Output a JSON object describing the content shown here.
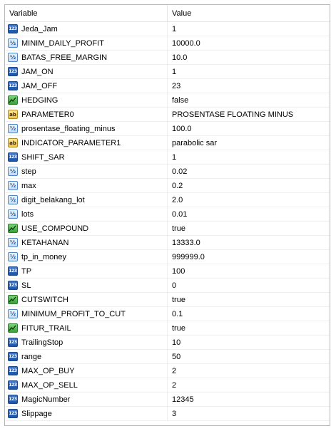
{
  "header": {
    "variable_label": "Variable",
    "value_label": "Value"
  },
  "rows": [
    {
      "type": "int",
      "icon": "integer-icon",
      "name": "Jeda_Jam",
      "value": "1"
    },
    {
      "type": "dbl",
      "icon": "double-icon",
      "name": "MINIM_DAILY_PROFIT",
      "value": "10000.0"
    },
    {
      "type": "dbl",
      "icon": "double-icon",
      "name": "BATAS_FREE_MARGIN",
      "value": "10.0"
    },
    {
      "type": "int",
      "icon": "integer-icon",
      "name": "JAM_ON",
      "value": "1"
    },
    {
      "type": "int",
      "icon": "integer-icon",
      "name": "JAM_OFF",
      "value": "23"
    },
    {
      "type": "bool",
      "icon": "boolean-icon",
      "name": "HEDGING",
      "value": "false"
    },
    {
      "type": "str",
      "icon": "string-icon",
      "name": "PARAMETER0",
      "value": "PROSENTASE FLOATING MINUS"
    },
    {
      "type": "dbl",
      "icon": "double-icon",
      "name": "prosentase_floating_minus",
      "value": "100.0"
    },
    {
      "type": "str",
      "icon": "string-icon",
      "name": "INDICATOR_PARAMETER1",
      "value": "parabolic sar"
    },
    {
      "type": "int",
      "icon": "integer-icon",
      "name": "SHIFT_SAR",
      "value": "1"
    },
    {
      "type": "dbl",
      "icon": "double-icon",
      "name": "step",
      "value": "0.02"
    },
    {
      "type": "dbl",
      "icon": "double-icon",
      "name": "max",
      "value": "0.2"
    },
    {
      "type": "dbl",
      "icon": "double-icon",
      "name": "digit_belakang_lot",
      "value": "2.0"
    },
    {
      "type": "dbl",
      "icon": "double-icon",
      "name": "lots",
      "value": "0.01"
    },
    {
      "type": "bool",
      "icon": "boolean-icon",
      "name": "USE_COMPOUND",
      "value": "true"
    },
    {
      "type": "dbl",
      "icon": "double-icon",
      "name": "KETAHANAN",
      "value": "13333.0"
    },
    {
      "type": "dbl",
      "icon": "double-icon",
      "name": "tp_in_money",
      "value": "999999.0"
    },
    {
      "type": "int",
      "icon": "integer-icon",
      "name": "TP",
      "value": "100"
    },
    {
      "type": "int",
      "icon": "integer-icon",
      "name": "SL",
      "value": "0"
    },
    {
      "type": "bool",
      "icon": "boolean-icon",
      "name": "CUTSWITCH",
      "value": "true"
    },
    {
      "type": "dbl",
      "icon": "double-icon",
      "name": "MINIMUM_PROFIT_TO_CUT",
      "value": "0.1"
    },
    {
      "type": "bool",
      "icon": "boolean-icon",
      "name": "FITUR_TRAIL",
      "value": "true"
    },
    {
      "type": "int",
      "icon": "integer-icon",
      "name": "TrailingStop",
      "value": "10"
    },
    {
      "type": "int",
      "icon": "integer-icon",
      "name": "range",
      "value": "50"
    },
    {
      "type": "int",
      "icon": "integer-icon",
      "name": "MAX_OP_BUY",
      "value": "2"
    },
    {
      "type": "int",
      "icon": "integer-icon",
      "name": "MAX_OP_SELL",
      "value": "2"
    },
    {
      "type": "int",
      "icon": "integer-icon",
      "name": "MagicNumber",
      "value": "12345"
    },
    {
      "type": "int",
      "icon": "integer-icon",
      "name": "Slippage",
      "value": "3"
    }
  ]
}
